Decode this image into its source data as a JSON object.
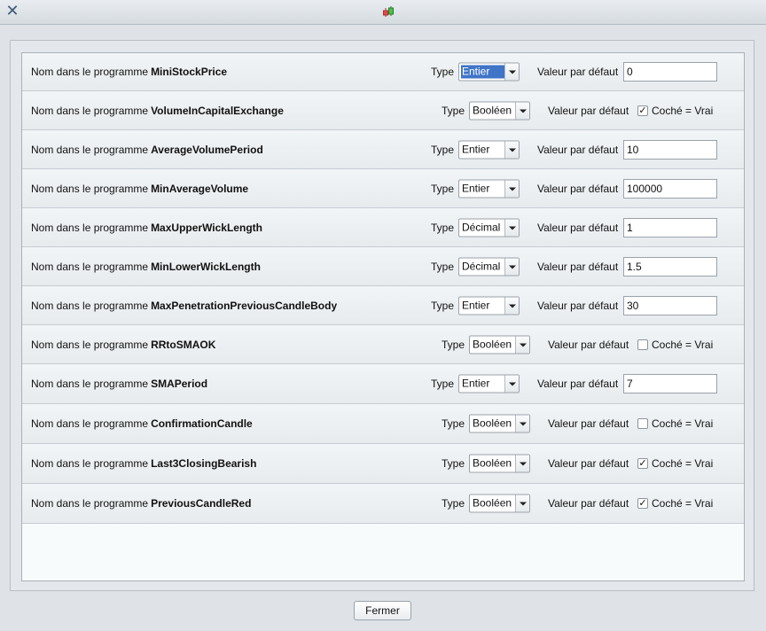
{
  "window": {
    "close_icon": "close-icon",
    "app_icon": "candlestick-icon"
  },
  "labels": {
    "name_prefix": "Nom dans le programme",
    "type": "Type",
    "default": "Valeur par défaut",
    "checked_text": "Coché = Vrai"
  },
  "params": [
    {
      "name": "MiniStockPrice",
      "type": "Entier",
      "value": "0",
      "selected": true
    },
    {
      "name": "VolumeInCapitalExchange",
      "type": "Booléen",
      "checked": true
    },
    {
      "name": "AverageVolumePeriod",
      "type": "Entier",
      "value": "10"
    },
    {
      "name": "MinAverageVolume",
      "type": "Entier",
      "value": "100000"
    },
    {
      "name": "MaxUpperWickLength",
      "type": "Décimal",
      "value": "1"
    },
    {
      "name": "MinLowerWickLength",
      "type": "Décimal",
      "value": "1.5"
    },
    {
      "name": "MaxPenetrationPreviousCandleBody",
      "type": "Entier",
      "value": "30"
    },
    {
      "name": "RRtoSMAOK",
      "type": "Booléen",
      "checked": false
    },
    {
      "name": "SMAPeriod",
      "type": "Entier",
      "value": "7"
    },
    {
      "name": "ConfirmationCandle",
      "type": "Booléen",
      "checked": false
    },
    {
      "name": "Last3ClosingBearish",
      "type": "Booléen",
      "checked": true
    },
    {
      "name": "PreviousCandleRed",
      "type": "Booléen",
      "checked": true
    }
  ],
  "footer": {
    "close_label": "Fermer"
  }
}
